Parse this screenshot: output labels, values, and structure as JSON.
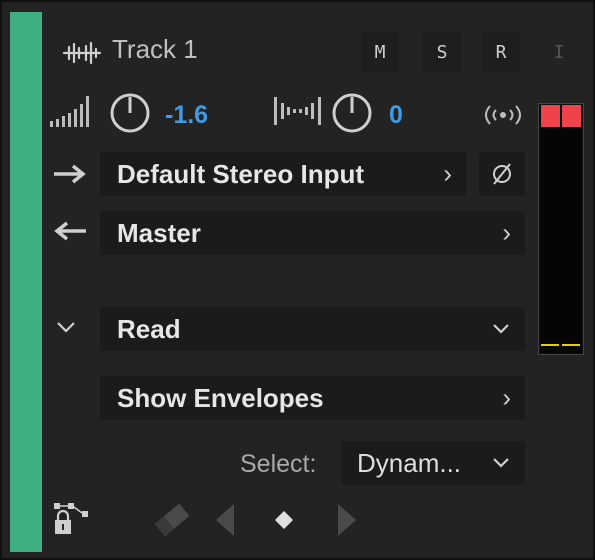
{
  "colors": {
    "track_color": "#3daf80",
    "clip_color": "#f0424a",
    "value_color": "#3f9be6",
    "meter_line": "#e3d300"
  },
  "track": {
    "name": "Track 1",
    "icon": "waveform-icon"
  },
  "buttons": {
    "mute": "M",
    "solo": "S",
    "record": "R",
    "input": "I"
  },
  "volume": {
    "icon": "volume-bars-icon",
    "value": "-1.6"
  },
  "pan": {
    "icon": "pan-icon",
    "value": "0"
  },
  "monitor_icon": "broadcast-icon",
  "input": {
    "value": "Default Stereo Input",
    "arrow_icon": "arrow-right-icon",
    "phase_icon": "phase-invert-icon"
  },
  "output": {
    "value": "Master",
    "arrow_icon": "arrow-left-icon"
  },
  "automation": {
    "mode": "Read",
    "show_envelopes": "Show Envelopes",
    "select_label": "Select:",
    "select_value": "Dynam..."
  },
  "footer": {
    "lock_icon": "lock-icon",
    "eraser_icon": "eraser-icon",
    "prev_icon": "prev-keyframe-icon",
    "add_icon": "add-keyframe-icon",
    "next_icon": "next-keyframe-icon"
  },
  "meter": {
    "clip_left": true,
    "clip_right": true
  }
}
